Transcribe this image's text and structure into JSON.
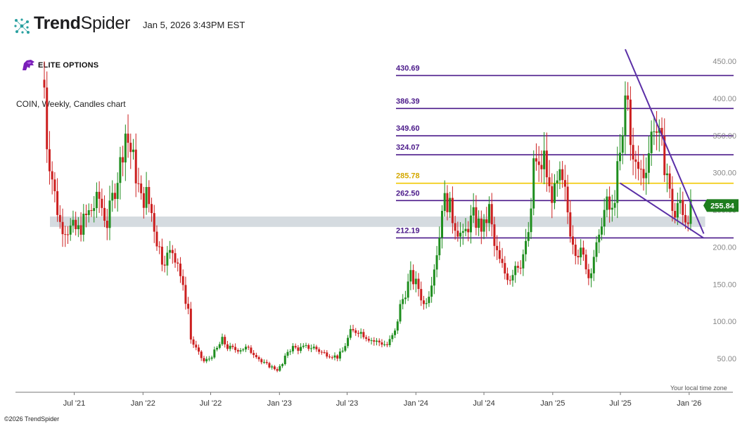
{
  "header": {
    "brand_bold": "Trend",
    "brand_light": "Spider",
    "timestamp": "Jan 5, 2026 3:43PM EST",
    "logo_icon": "trendspider-logo-icon"
  },
  "watermark": {
    "text": "ELITE OPTIONS",
    "icon": "lion-logo-icon",
    "color": "#7a1fb8"
  },
  "chart_title": "COIN, Weekly, Candles chart",
  "time_zone_note": "Your local time zone",
  "footer": "©2026 TrendSpider",
  "chart_data": {
    "type": "candlestick",
    "title": "COIN, Weekly, Candles chart",
    "xlabel": "",
    "ylabel": "",
    "ylim": [
      0,
      470
    ],
    "y_ticks": [
      50,
      100,
      150,
      200,
      250,
      300,
      350,
      400,
      450
    ],
    "y_tick_labels": [
      "50.00",
      "100.00",
      "150.00",
      "200.00",
      "250.00",
      "300.00",
      "350.00",
      "400.00",
      "450.00"
    ],
    "x_range": [
      "2021-04-12",
      "2026-02-23"
    ],
    "x_ticks": [
      {
        "label": "Jul '21",
        "date": "2021-07-01"
      },
      {
        "label": "Jan '22",
        "date": "2022-01-01"
      },
      {
        "label": "Jul '22",
        "date": "2022-07-01"
      },
      {
        "label": "Jan '23",
        "date": "2023-01-01"
      },
      {
        "label": "Jul '23",
        "date": "2023-07-01"
      },
      {
        "label": "Jan '24",
        "date": "2024-01-01"
      },
      {
        "label": "Jul '24",
        "date": "2024-07-01"
      },
      {
        "label": "Jan '25",
        "date": "2025-01-01"
      },
      {
        "label": "Jul '25",
        "date": "2025-07-01"
      },
      {
        "label": "Jan '26",
        "date": "2026-01-01"
      }
    ],
    "last_price": {
      "value": 255.84,
      "label": "255.84",
      "color": "#1e7d1e"
    },
    "colors": {
      "up": "#1e8e1e",
      "down": "#cc1f1f",
      "level": "#4b1a8a",
      "highlight": "#f0c800",
      "zone": "#d3d9de",
      "trendline": "#5a2ea6"
    },
    "horizontal_levels": [
      {
        "value": 430.69,
        "label": "430.69",
        "color": "#4b1a8a"
      },
      {
        "value": 386.39,
        "label": "386.39",
        "color": "#4b1a8a"
      },
      {
        "value": 349.6,
        "label": "349.60",
        "color": "#4b1a8a"
      },
      {
        "value": 324.07,
        "label": "324.07",
        "color": "#4b1a8a"
      },
      {
        "value": 285.78,
        "label": "285.78",
        "color": "#f0c800"
      },
      {
        "value": 262.5,
        "label": "262.50",
        "color": "#4b1a8a"
      },
      {
        "value": 212.19,
        "label": "212.19",
        "color": "#4b1a8a"
      }
    ],
    "support_zone": {
      "from_date": "2021-04-12",
      "to_date": "2026-02-09",
      "low": 227,
      "high": 241
    },
    "trendlines": [
      {
        "from": {
          "date": "2025-07-14",
          "value": 466
        },
        "to": {
          "date": "2026-02-09",
          "value": 218
        }
      },
      {
        "from": {
          "date": "2025-06-30",
          "value": 286
        },
        "to": {
          "date": "2026-02-09",
          "value": 212
        }
      }
    ],
    "price_path": [
      [
        "2021-04-12",
        415
      ],
      [
        "2021-04-19",
        342
      ],
      [
        "2021-05-10",
        270
      ],
      [
        "2021-05-24",
        232
      ],
      [
        "2021-06-14",
        225
      ],
      [
        "2021-07-12",
        222
      ],
      [
        "2021-08-02",
        240
      ],
      [
        "2021-08-16",
        250
      ],
      [
        "2021-09-06",
        265
      ],
      [
        "2021-09-27",
        232
      ],
      [
        "2021-10-11",
        265
      ],
      [
        "2021-11-01",
        312
      ],
      [
        "2021-11-15",
        355
      ],
      [
        "2021-12-06",
        316
      ],
      [
        "2021-12-27",
        262
      ],
      [
        "2022-01-10",
        270
      ],
      [
        "2022-01-24",
        246
      ],
      [
        "2022-02-07",
        210
      ],
      [
        "2022-02-21",
        185
      ],
      [
        "2022-03-07",
        187
      ],
      [
        "2022-03-21",
        195
      ],
      [
        "2022-04-04",
        182
      ],
      [
        "2022-04-18",
        142
      ],
      [
        "2022-05-02",
        117
      ],
      [
        "2022-05-09",
        76
      ],
      [
        "2022-05-30",
        56
      ],
      [
        "2022-06-13",
        46
      ],
      [
        "2022-06-27",
        50
      ],
      [
        "2022-07-18",
        63
      ],
      [
        "2022-08-01",
        75
      ],
      [
        "2022-08-15",
        65
      ],
      [
        "2022-09-05",
        62
      ],
      [
        "2022-10-03",
        64
      ],
      [
        "2022-10-31",
        55
      ],
      [
        "2022-11-14",
        45
      ],
      [
        "2022-12-05",
        40
      ],
      [
        "2022-12-26",
        35
      ],
      [
        "2023-01-09",
        42
      ],
      [
        "2023-01-23",
        60
      ],
      [
        "2023-02-06",
        65
      ],
      [
        "2023-02-20",
        63
      ],
      [
        "2023-03-13",
        65
      ],
      [
        "2023-04-03",
        65
      ],
      [
        "2023-04-24",
        58
      ],
      [
        "2023-05-15",
        55
      ],
      [
        "2023-06-05",
        52
      ],
      [
        "2023-06-19",
        60
      ],
      [
        "2023-07-10",
        85
      ],
      [
        "2023-07-31",
        88
      ],
      [
        "2023-08-21",
        80
      ],
      [
        "2023-09-11",
        73
      ],
      [
        "2023-09-25",
        72
      ],
      [
        "2023-10-16",
        68
      ],
      [
        "2023-11-06",
        85
      ],
      [
        "2023-11-20",
        120
      ],
      [
        "2023-12-04",
        140
      ],
      [
        "2023-12-18",
        160
      ],
      [
        "2024-01-08",
        145
      ],
      [
        "2024-01-22",
        122
      ],
      [
        "2024-02-05",
        140
      ],
      [
        "2024-02-19",
        175
      ],
      [
        "2024-03-04",
        215
      ],
      [
        "2024-03-11",
        260
      ],
      [
        "2024-03-25",
        262
      ],
      [
        "2024-04-08",
        240
      ],
      [
        "2024-04-22",
        225
      ],
      [
        "2024-05-06",
        210
      ],
      [
        "2024-05-20",
        230
      ],
      [
        "2024-06-03",
        240
      ],
      [
        "2024-06-17",
        230
      ],
      [
        "2024-07-01",
        225
      ],
      [
        "2024-07-15",
        250
      ],
      [
        "2024-07-29",
        200
      ],
      [
        "2024-08-12",
        180
      ],
      [
        "2024-08-26",
        165
      ],
      [
        "2024-09-09",
        160
      ],
      [
        "2024-09-23",
        178
      ],
      [
        "2024-10-07",
        180
      ],
      [
        "2024-10-21",
        200
      ],
      [
        "2024-11-04",
        240
      ],
      [
        "2024-11-11",
        320
      ],
      [
        "2024-11-25",
        300
      ],
      [
        "2024-12-09",
        320
      ],
      [
        "2024-12-23",
        275
      ],
      [
        "2025-01-06",
        270
      ],
      [
        "2025-01-20",
        290
      ],
      [
        "2025-02-03",
        270
      ],
      [
        "2025-02-17",
        225
      ],
      [
        "2025-03-03",
        200
      ],
      [
        "2025-03-17",
        190
      ],
      [
        "2025-03-31",
        178
      ],
      [
        "2025-04-07",
        160
      ],
      [
        "2025-04-21",
        190
      ],
      [
        "2025-05-05",
        205
      ],
      [
        "2025-05-12",
        240
      ],
      [
        "2025-05-26",
        255
      ],
      [
        "2025-06-09",
        245
      ],
      [
        "2025-06-23",
        300
      ],
      [
        "2025-07-07",
        340
      ],
      [
        "2025-07-14",
        400
      ],
      [
        "2025-07-21",
        395
      ],
      [
        "2025-08-04",
        310
      ],
      [
        "2025-08-18",
        305
      ],
      [
        "2025-09-01",
        300
      ],
      [
        "2025-09-15",
        330
      ],
      [
        "2025-09-29",
        370
      ],
      [
        "2025-10-06",
        355
      ],
      [
        "2025-10-20",
        330
      ],
      [
        "2025-11-03",
        300
      ],
      [
        "2025-11-10",
        270
      ],
      [
        "2025-11-24",
        240
      ],
      [
        "2025-12-08",
        262
      ],
      [
        "2025-12-22",
        240
      ],
      [
        "2026-01-05",
        250
      ]
    ]
  }
}
